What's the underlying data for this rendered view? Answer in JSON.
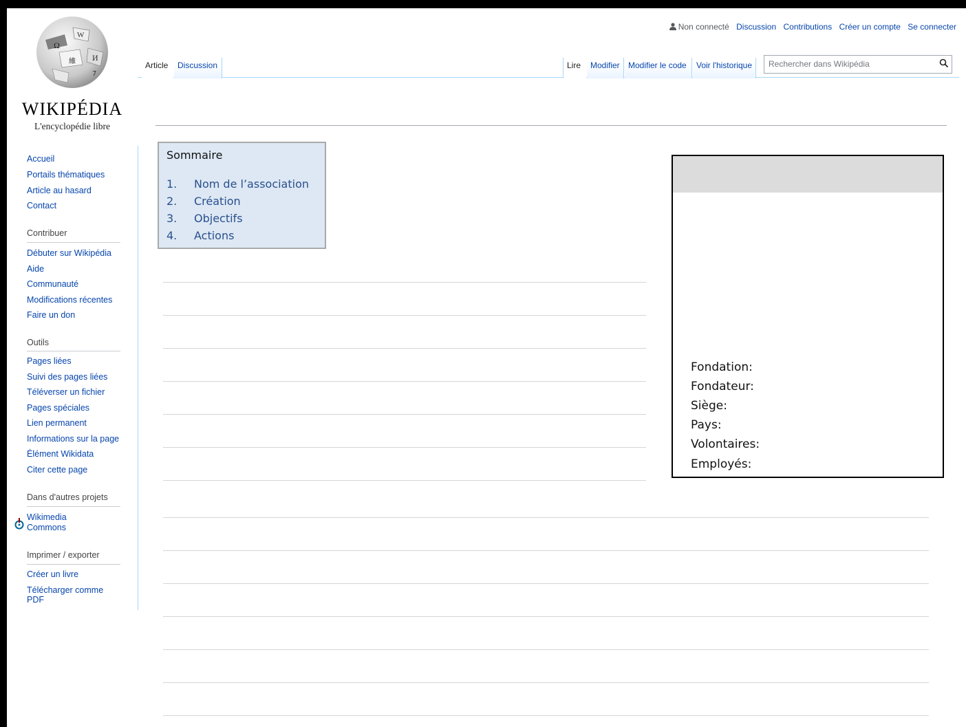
{
  "logo": {
    "wordmark": "WIKIPÉDIA",
    "tagline": "L'encyclopédie libre"
  },
  "personal": {
    "user": "Non connecté",
    "discussion": "Discussion",
    "contributions": "Contributions",
    "create_account": "Créer un compte",
    "login": "Se connecter"
  },
  "tabs": {
    "article": "Article",
    "discussion": "Discussion",
    "read": "Lire",
    "edit": "Modifier",
    "edit_source": "Modifier le code",
    "history": "Voir l'historique"
  },
  "search": {
    "placeholder": "Rechercher dans Wikipédia"
  },
  "sidebar": {
    "main": [
      "Accueil",
      "Portails thématiques",
      "Article au hasard",
      "Contact"
    ],
    "contribute_head": "Contribuer",
    "contribute": [
      "Débuter sur Wikipédia",
      "Aide",
      "Communauté",
      "Modifications récentes",
      "Faire un don"
    ],
    "tools_head": "Outils",
    "tools": [
      "Pages liées",
      "Suivi des pages liées",
      "Téléverser un fichier",
      "Pages spéciales",
      "Lien permanent",
      "Informations sur la page",
      "Élément Wikidata",
      "Citer cette page"
    ],
    "projects_head": "Dans d'autres projets",
    "projects": [
      "Wikimedia",
      "Commons"
    ],
    "print_head": "Imprimer / exporter",
    "print": [
      "Créer un livre",
      "Télécharger comme",
      "PDF"
    ]
  },
  "toc": {
    "title": "Sommaire",
    "items": [
      {
        "num": "1.",
        "label": "Nom de l’association"
      },
      {
        "num": "2.",
        "label": "Création"
      },
      {
        "num": "3.",
        "label": "Objectifs"
      },
      {
        "num": "4.",
        "label": "Actions"
      }
    ]
  },
  "infobox": {
    "labels": [
      "Fondation:",
      "Fondateur:",
      "Siège:",
      "Pays:",
      "Volontaires:",
      "Employés:"
    ]
  },
  "colors": {
    "link": "#0645ad",
    "toc_bg": "#dde8f4",
    "infobox_header": "#dcdcdc"
  }
}
